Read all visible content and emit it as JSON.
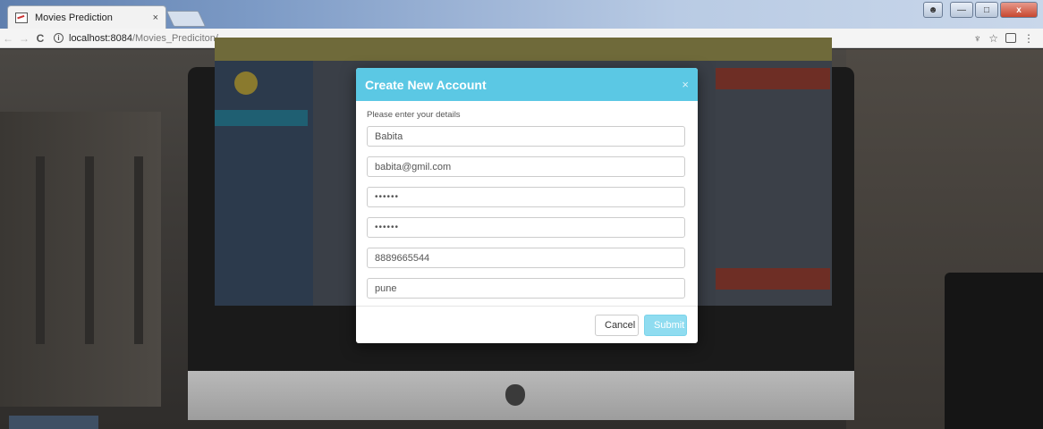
{
  "browser": {
    "tab_title": "Movies Prediction",
    "tab_close": "×",
    "url_host": "localhost:8084",
    "url_path": "/Movies_Prediciton/",
    "nav": {
      "back": "←",
      "forward": "→",
      "reload": "C"
    },
    "info_icon": "i",
    "toolbar_icons": {
      "extension": "♆",
      "bookmark": "☆",
      "menu": "⋮"
    },
    "window_buttons": {
      "minimize": "—",
      "maximize": "□",
      "close": "x"
    }
  },
  "modal": {
    "title": "Create New Account",
    "close": "×",
    "description": "Please enter your details",
    "fields": {
      "name": "Babita",
      "email": "babita@gmil.com",
      "password": "••••••",
      "confirm_password": "••••••",
      "phone": "8889665544",
      "city": "pune"
    },
    "buttons": {
      "cancel": "Cancel",
      "submit": "Submit"
    }
  },
  "colors": {
    "modal_header": "#5bc8e4",
    "submit_button": "#8fdcf0"
  }
}
